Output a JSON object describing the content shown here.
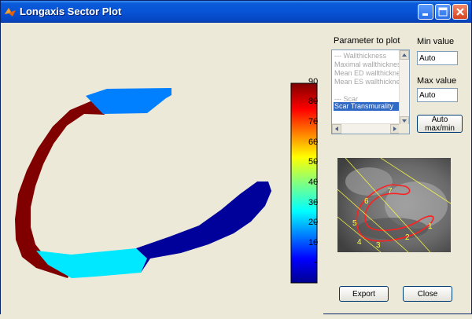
{
  "window": {
    "title": "Longaxis Sector Plot",
    "icon": "matlab-icon",
    "controls": [
      "minimize-icon",
      "maximize-icon",
      "close-icon"
    ]
  },
  "panel": {
    "parameter_label": "Parameter to plot",
    "parameter_items": [
      "--- Wallthickness",
      "Maximal wallthickness",
      "Mean ED wallthickness",
      "Mean ES wallthickness",
      "",
      "--- Scar",
      "Scar Transmurality"
    ],
    "selected_parameter": "Scar Transmurality",
    "min_label": "Min value",
    "min_value": "Auto",
    "max_label": "Max value",
    "max_value": "Auto",
    "auto_button": "Auto max/min",
    "export_button": "Export",
    "close_button": "Close"
  },
  "colorbar": {
    "ticks": [
      "90",
      "80",
      "70",
      "60",
      "50",
      "40",
      "30",
      "20",
      "10"
    ],
    "colors": [
      "#00008f",
      "#0000ff",
      "#0080ff",
      "#00ffff",
      "#80ff80",
      "#ffff00",
      "#ff8000",
      "#ff0000",
      "#800000"
    ]
  },
  "sector_plot": {
    "colors": {
      "dark_red": "#800000",
      "light_blue": "#0080ff",
      "cyan": "#00e8ff",
      "dark_blue": "#00009a"
    }
  },
  "thumbnail": {
    "sector_numbers": [
      "1",
      "2",
      "3",
      "4",
      "5",
      "6",
      "7"
    ],
    "outline_color": "#ff2020",
    "sector_line_color": "#ffff40",
    "label_color": "#ffff40"
  }
}
